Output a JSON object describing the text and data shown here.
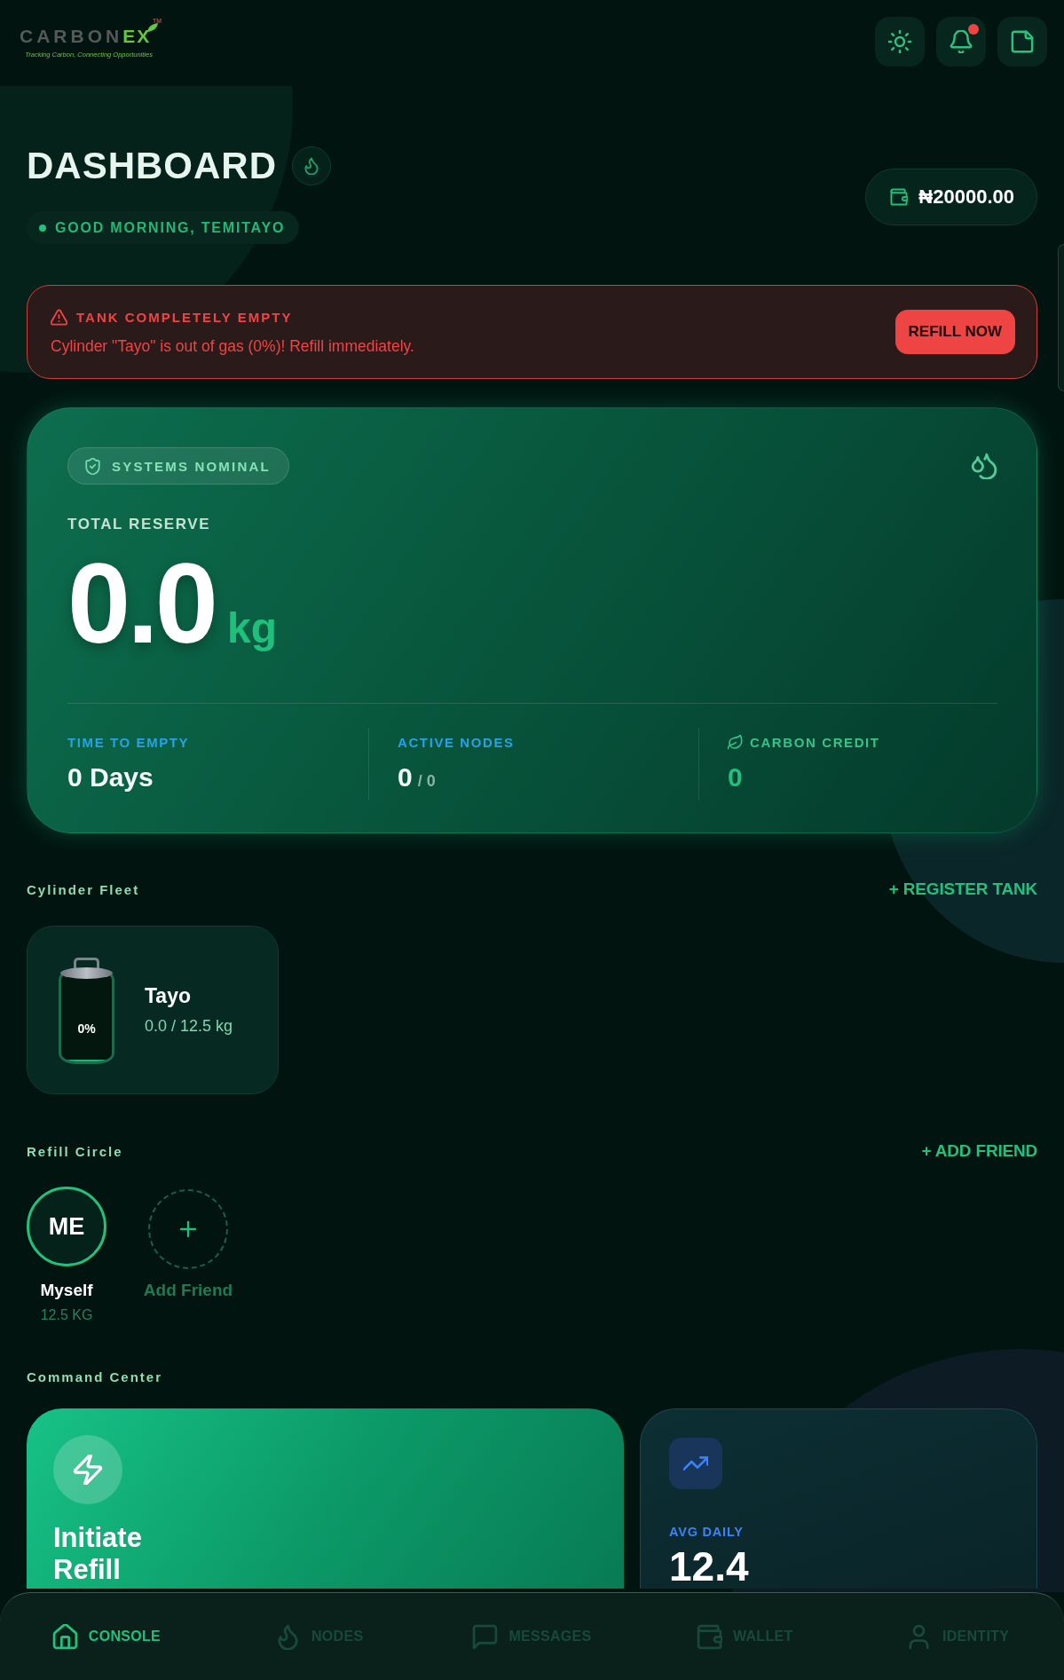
{
  "header": {
    "logo": {
      "wordmark": {
        "text": "CARBON",
        "accent_text": "EX"
      },
      "trademark": "TM",
      "tagline": "Tracking Carbon, Connecting Opportunities"
    },
    "actions": [
      {
        "kind": "theme"
      },
      {
        "kind": "notifications",
        "unread": true
      },
      {
        "kind": "document"
      }
    ]
  },
  "dashboard": {
    "title": "DASHBOARD",
    "greeting": "GOOD MORNING, TEMITAYO",
    "balance": "₦20000.00"
  },
  "alert": {
    "title": "TANK COMPLETELY EMPTY",
    "message": "Cylinder \"Tayo\" is out of gas (0%)! Refill immediately.",
    "action": "REFILL NOW"
  },
  "reserve": {
    "status": "SYSTEMS NOMINAL",
    "label": "TOTAL RESERVE",
    "value": "0.0",
    "unit": "kg",
    "stats": [
      {
        "kind": "time",
        "label": "TIME TO EMPTY",
        "value": "0 Days"
      },
      {
        "kind": "nodes",
        "label": "ACTIVE NODES",
        "value": "0",
        "total": "/ 0"
      },
      {
        "kind": "credit",
        "label": "CARBON CREDIT",
        "value": "0"
      }
    ]
  },
  "cylinder_fleet": {
    "title": "Cylinder Fleet",
    "action": "+ REGISTER TANK",
    "cylinders": [
      {
        "name": "Tayo",
        "percent": "0%",
        "reading": "0.0 / 12.5 kg",
        "level": 0
      }
    ]
  },
  "refill_circle": {
    "title": "Refill Circle",
    "action": "+ ADD FRIEND",
    "members": [
      {
        "kind": "member",
        "initials": "ME",
        "name": "Myself",
        "amount": "12.5 KG"
      },
      {
        "kind": "add",
        "name": "Add Friend"
      }
    ]
  },
  "command_center": {
    "title": "Command Center",
    "cards": [
      {
        "kind": "action",
        "title": "Initiate Refill"
      },
      {
        "kind": "stat",
        "label": "AVG DAILY",
        "value": "12.4"
      }
    ]
  },
  "nav": [
    {
      "kind": "home",
      "label": "CONSOLE",
      "selected": true
    },
    {
      "kind": "flame",
      "label": "NODES",
      "selected": false
    },
    {
      "kind": "chat",
      "label": "MESSAGES",
      "selected": false
    },
    {
      "kind": "wallet",
      "label": "WALLET",
      "selected": false
    },
    {
      "kind": "user",
      "label": "IDENTITY",
      "selected": false
    }
  ]
}
